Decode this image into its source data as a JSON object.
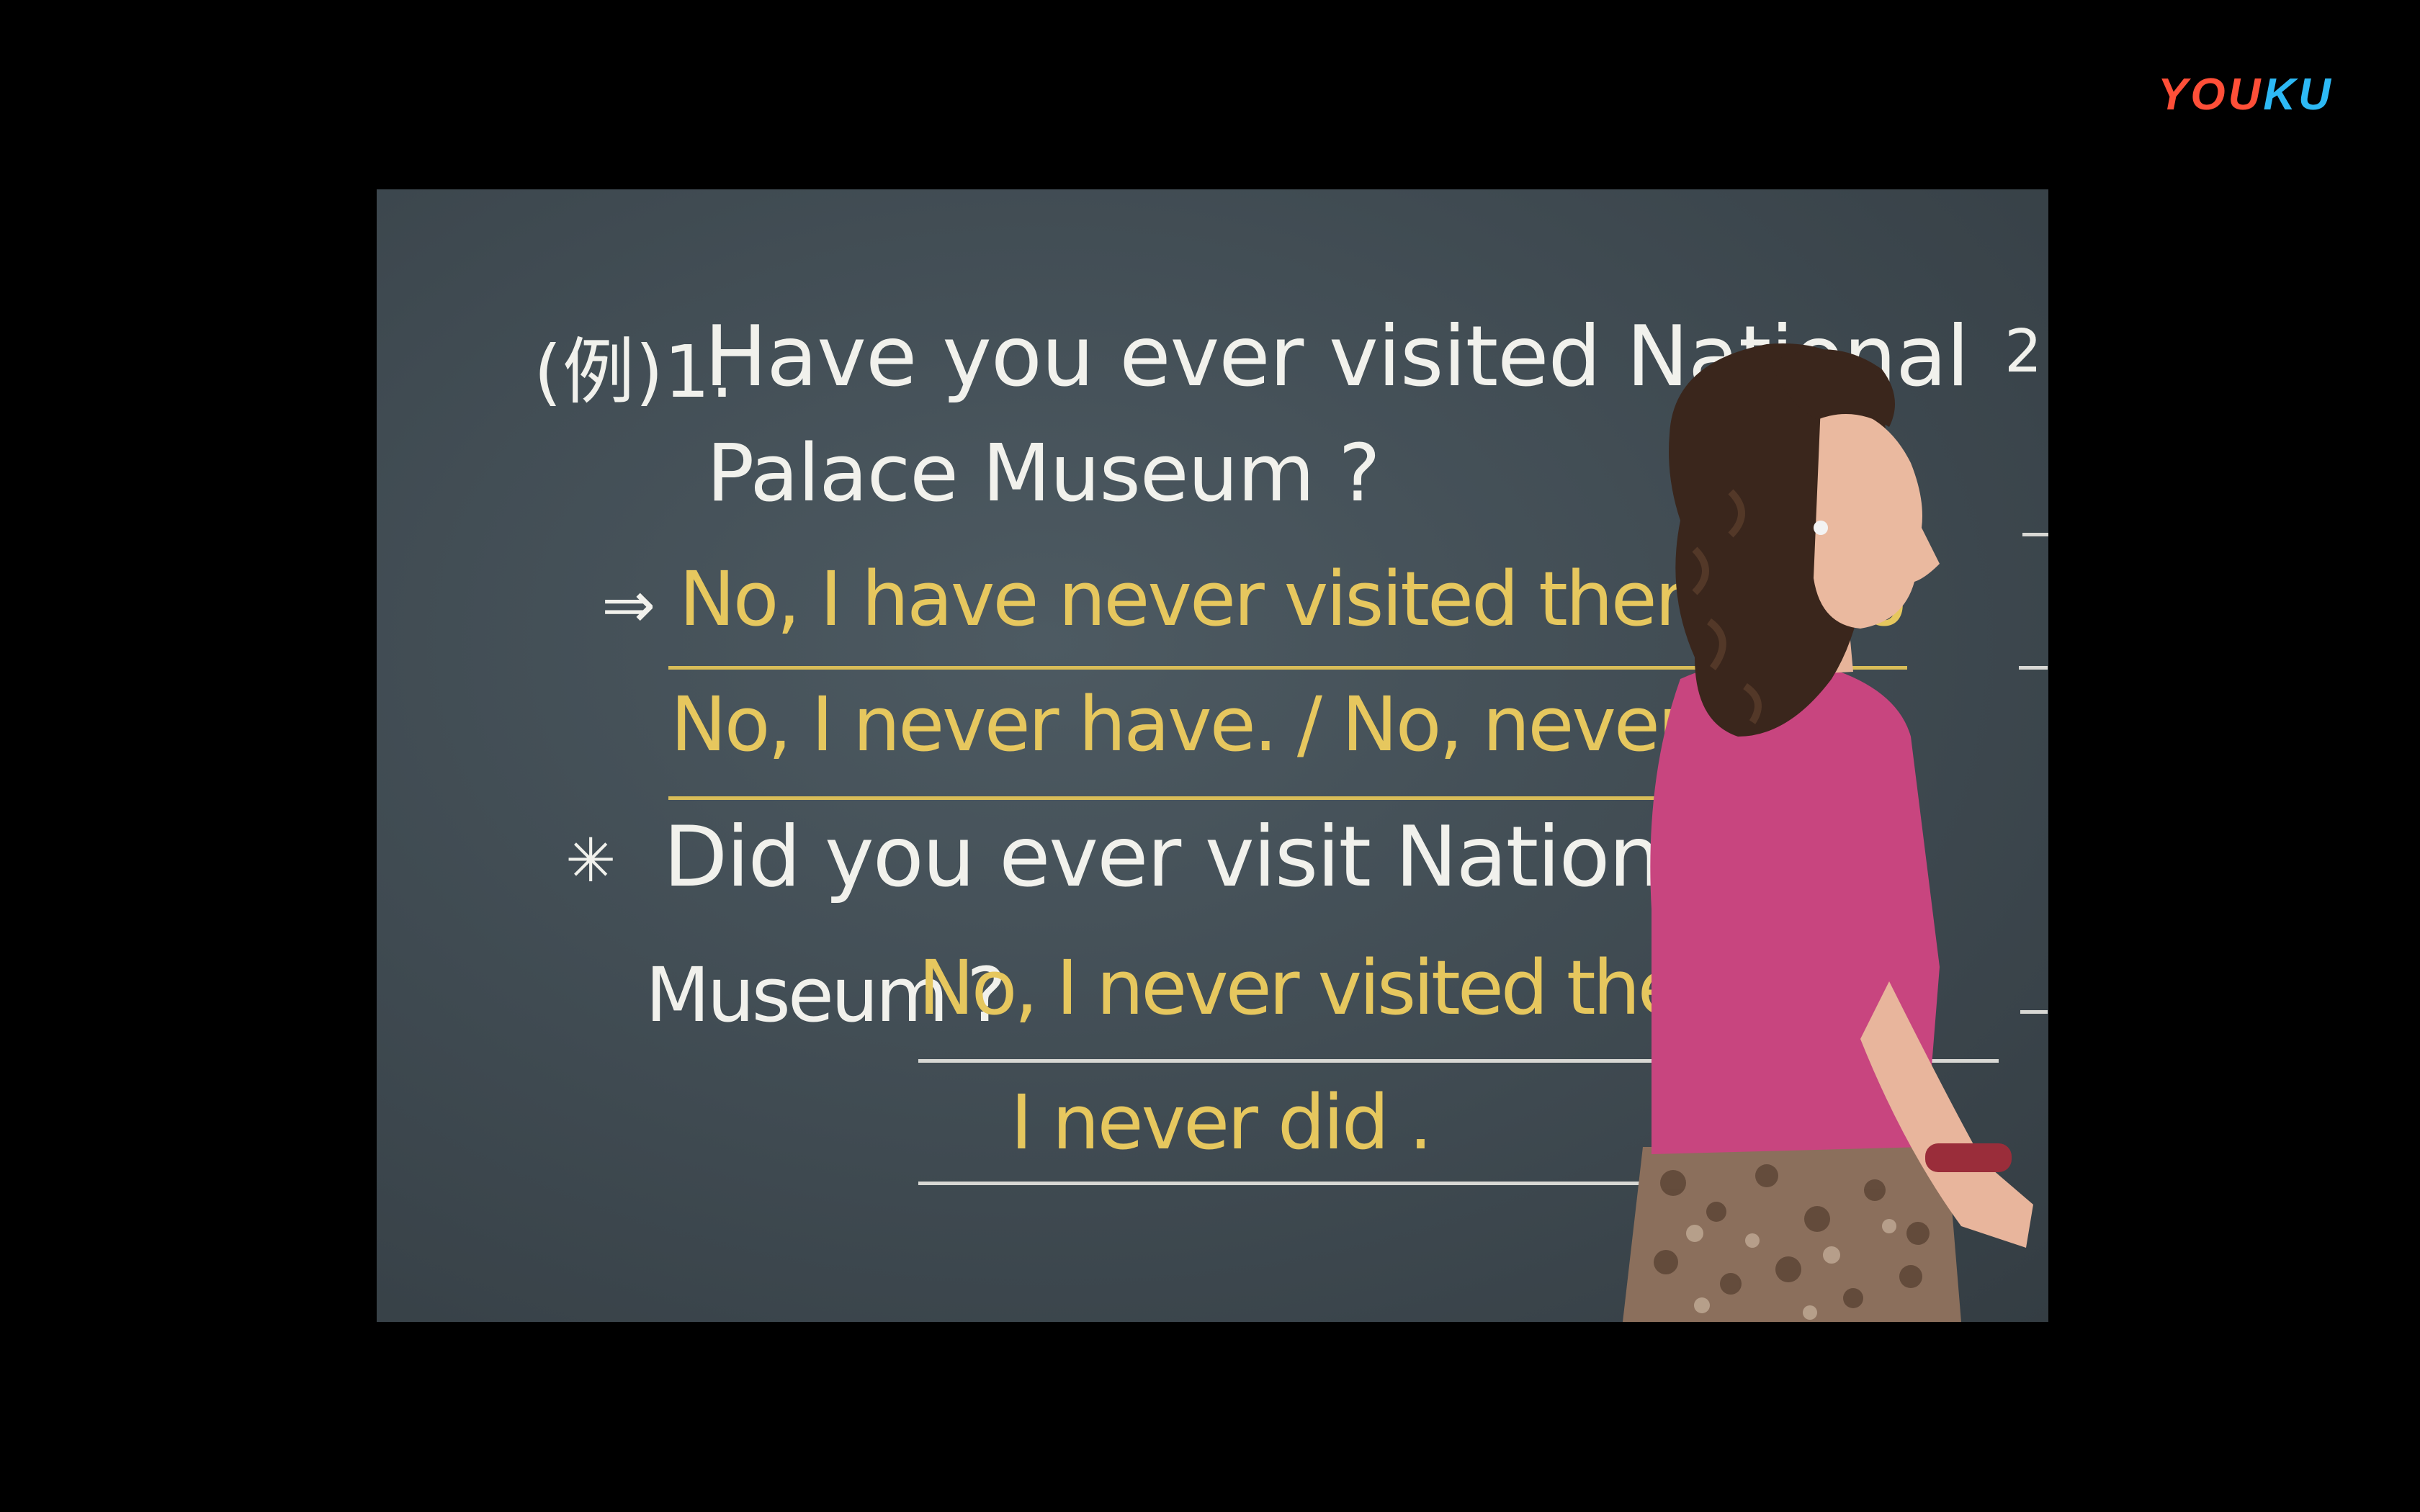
{
  "logo": {
    "part1": "YOU",
    "part2": "KU",
    "color1": "#ff4f38",
    "color2": "#2db9f5"
  },
  "board": {
    "label": "(例)1.",
    "q1_line1": "Have you ever visited National",
    "q1_line2": "Palace Museum ?",
    "arrow": "⇒",
    "a1_line1": "No, I have never visited there befo",
    "a1_line2": "No, I never have. / No, never.",
    "star": "✳",
    "q2_line1": "Did you ever visit National Pa",
    "q2_line2_label": "Museum ?",
    "a2_line1": "No, I never visited there be",
    "a2_line2": "I never did .",
    "edge_number": "2.",
    "chalk_white": "#f1f1ec",
    "chalk_yellow": "#e6c75e"
  }
}
